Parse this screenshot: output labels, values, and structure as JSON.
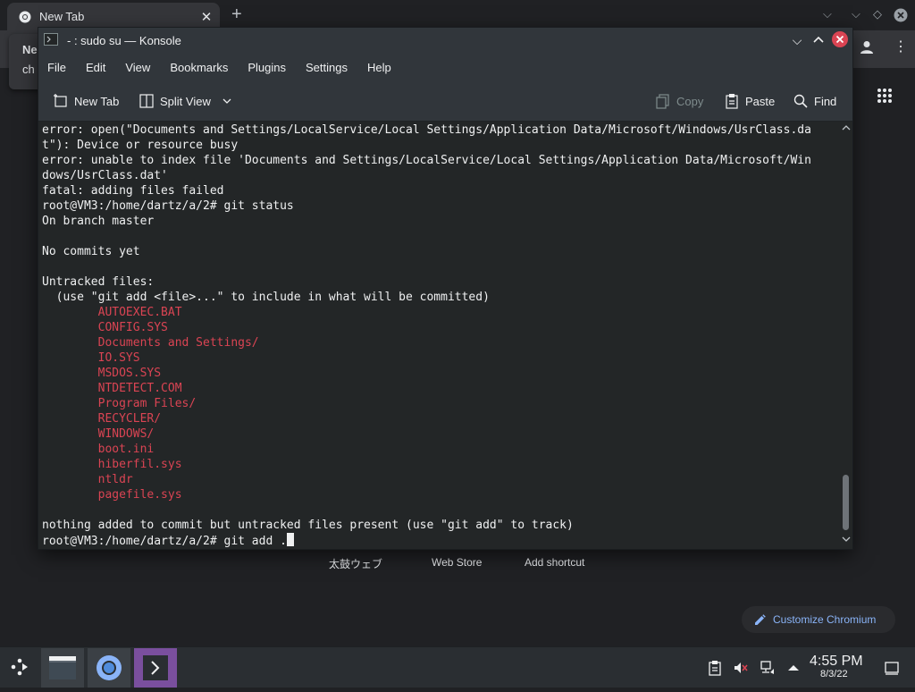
{
  "chromium": {
    "tab_title": "New Tab",
    "tab_close": "✕",
    "new_tab": "+",
    "suggestion_title": "Ne",
    "suggestion_sub": "ch",
    "shortcuts": [
      "太鼓ウェブ",
      "Web Store",
      "Add shortcut"
    ],
    "customize_label": "Customize Chromium"
  },
  "konsole": {
    "title": "- : sudo su — Konsole",
    "menu": [
      "File",
      "Edit",
      "View",
      "Bookmarks",
      "Plugins",
      "Settings",
      "Help"
    ],
    "toolbar": {
      "new_tab": "New Tab",
      "split_view": "Split View",
      "copy": "Copy",
      "paste": "Paste",
      "find": "Find"
    },
    "terminal_lines": [
      {
        "text": "error: open(\"Documents and Settings/LocalService/Local Settings/Application Data/Microsoft/Windows/UsrClass.da",
        "color": "normal"
      },
      {
        "text": "t\"): Device or resource busy",
        "color": "normal"
      },
      {
        "text": "error: unable to index file 'Documents and Settings/LocalService/Local Settings/Application Data/Microsoft/Win",
        "color": "normal"
      },
      {
        "text": "dows/UsrClass.dat'",
        "color": "normal"
      },
      {
        "text": "fatal: adding files failed",
        "color": "normal"
      },
      {
        "text": "root@VM3:/home/dartz/a/2# git status",
        "color": "normal"
      },
      {
        "text": "On branch master",
        "color": "normal"
      },
      {
        "text": "",
        "color": "normal"
      },
      {
        "text": "No commits yet",
        "color": "normal"
      },
      {
        "text": "",
        "color": "normal"
      },
      {
        "text": "Untracked files:",
        "color": "normal"
      },
      {
        "text": "  (use \"git add <file>...\" to include in what will be committed)",
        "color": "normal"
      },
      {
        "text": "        AUTOEXEC.BAT",
        "color": "red"
      },
      {
        "text": "        CONFIG.SYS",
        "color": "red"
      },
      {
        "text": "        Documents and Settings/",
        "color": "red"
      },
      {
        "text": "        IO.SYS",
        "color": "red"
      },
      {
        "text": "        MSDOS.SYS",
        "color": "red"
      },
      {
        "text": "        NTDETECT.COM",
        "color": "red"
      },
      {
        "text": "        Program Files/",
        "color": "red"
      },
      {
        "text": "        RECYCLER/",
        "color": "red"
      },
      {
        "text": "        WINDOWS/",
        "color": "red"
      },
      {
        "text": "        boot.ini",
        "color": "red"
      },
      {
        "text": "        hiberfil.sys",
        "color": "red"
      },
      {
        "text": "        ntldr",
        "color": "red"
      },
      {
        "text": "        pagefile.sys",
        "color": "red"
      },
      {
        "text": "",
        "color": "normal"
      },
      {
        "text": "nothing added to commit but untracked files present (use \"git add\" to track)",
        "color": "normal"
      }
    ],
    "prompt": "root@VM3:/home/dartz/a/2# git add ."
  },
  "taskbar": {
    "apps": [
      "file-manager-icon",
      "chromium-icon",
      "konsole-icon"
    ],
    "tray": [
      "clipboard-icon",
      "volume-muted-icon",
      "network-icon",
      "tray-expand-icon",
      "show-desktop-icon"
    ],
    "time": "4:55 PM",
    "date": "8/3/22"
  },
  "colors": {
    "terminal_bg": "#232627",
    "terminal_red": "#da4453",
    "active_task": "#7a4f9e",
    "close_button": "#da4453",
    "link_blue": "#8ab4f8"
  }
}
